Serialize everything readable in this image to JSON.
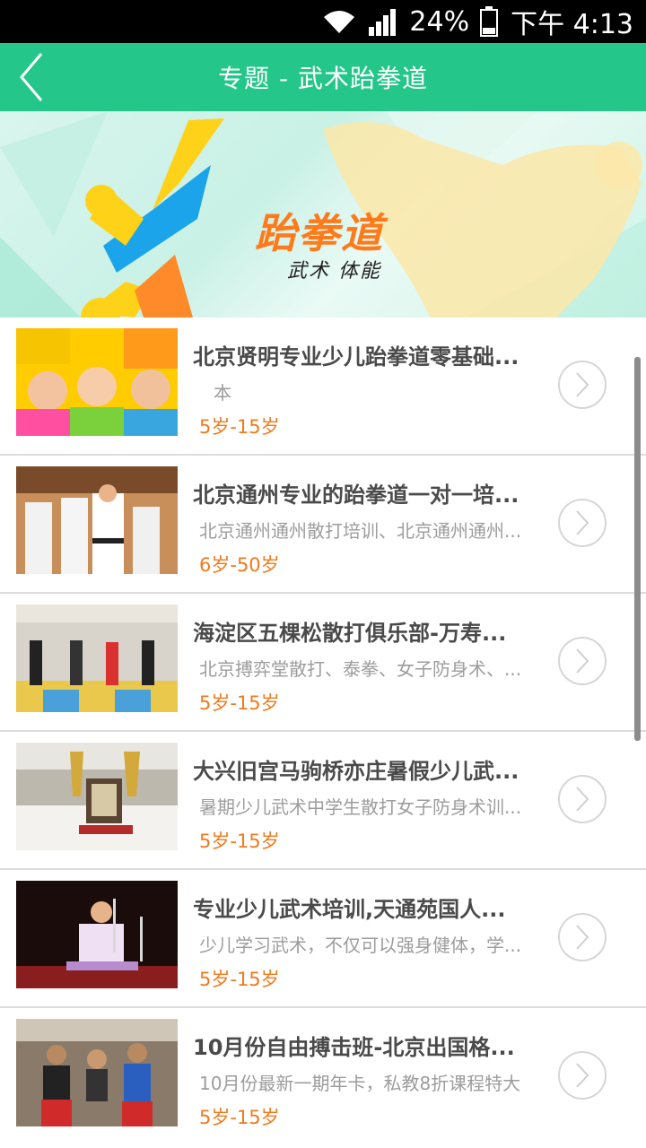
{
  "status_bar": {
    "battery": "24%",
    "time": "下午 4:13",
    "icons": [
      "wifi-icon",
      "signal-icon",
      "battery-icon"
    ]
  },
  "header": {
    "title": "专题 - 武术跆拳道",
    "back_icon": "chevron-left-icon"
  },
  "banner": {
    "title": "跆拳道",
    "subtitle": "武术 体能"
  },
  "colors": {
    "header": "#24c68a",
    "age": "#f07a1c"
  },
  "items": [
    {
      "title": "北京贤明专业少儿跆拳道零基础...",
      "desc": "本",
      "age": "5岁-15岁"
    },
    {
      "title": "北京通州专业的跆拳道一对一培...",
      "desc": "北京通州通州散打培训、北京通州通州...",
      "age": "6岁-50岁"
    },
    {
      "title": "海淀区五棵松散打俱乐部-万寿...",
      "desc": "北京搏弈堂散打、泰拳、女子防身术、...",
      "age": "5岁-15岁"
    },
    {
      "title": "大兴旧宫马驹桥亦庄暑假少儿武...",
      "desc": "暑期少儿武术中学生散打女子防身术训...",
      "age": "5岁-15岁"
    },
    {
      "title": "专业少儿武术培训,天通苑国人...",
      "desc": "少儿学习武术，不仅可以强身健体，学...",
      "age": "5岁-15岁"
    },
    {
      "title": "10月份自由搏击班-北京出国格...",
      "desc": "10月份最新一期年卡，私教8折课程特大",
      "age": "5岁-15岁"
    }
  ]
}
